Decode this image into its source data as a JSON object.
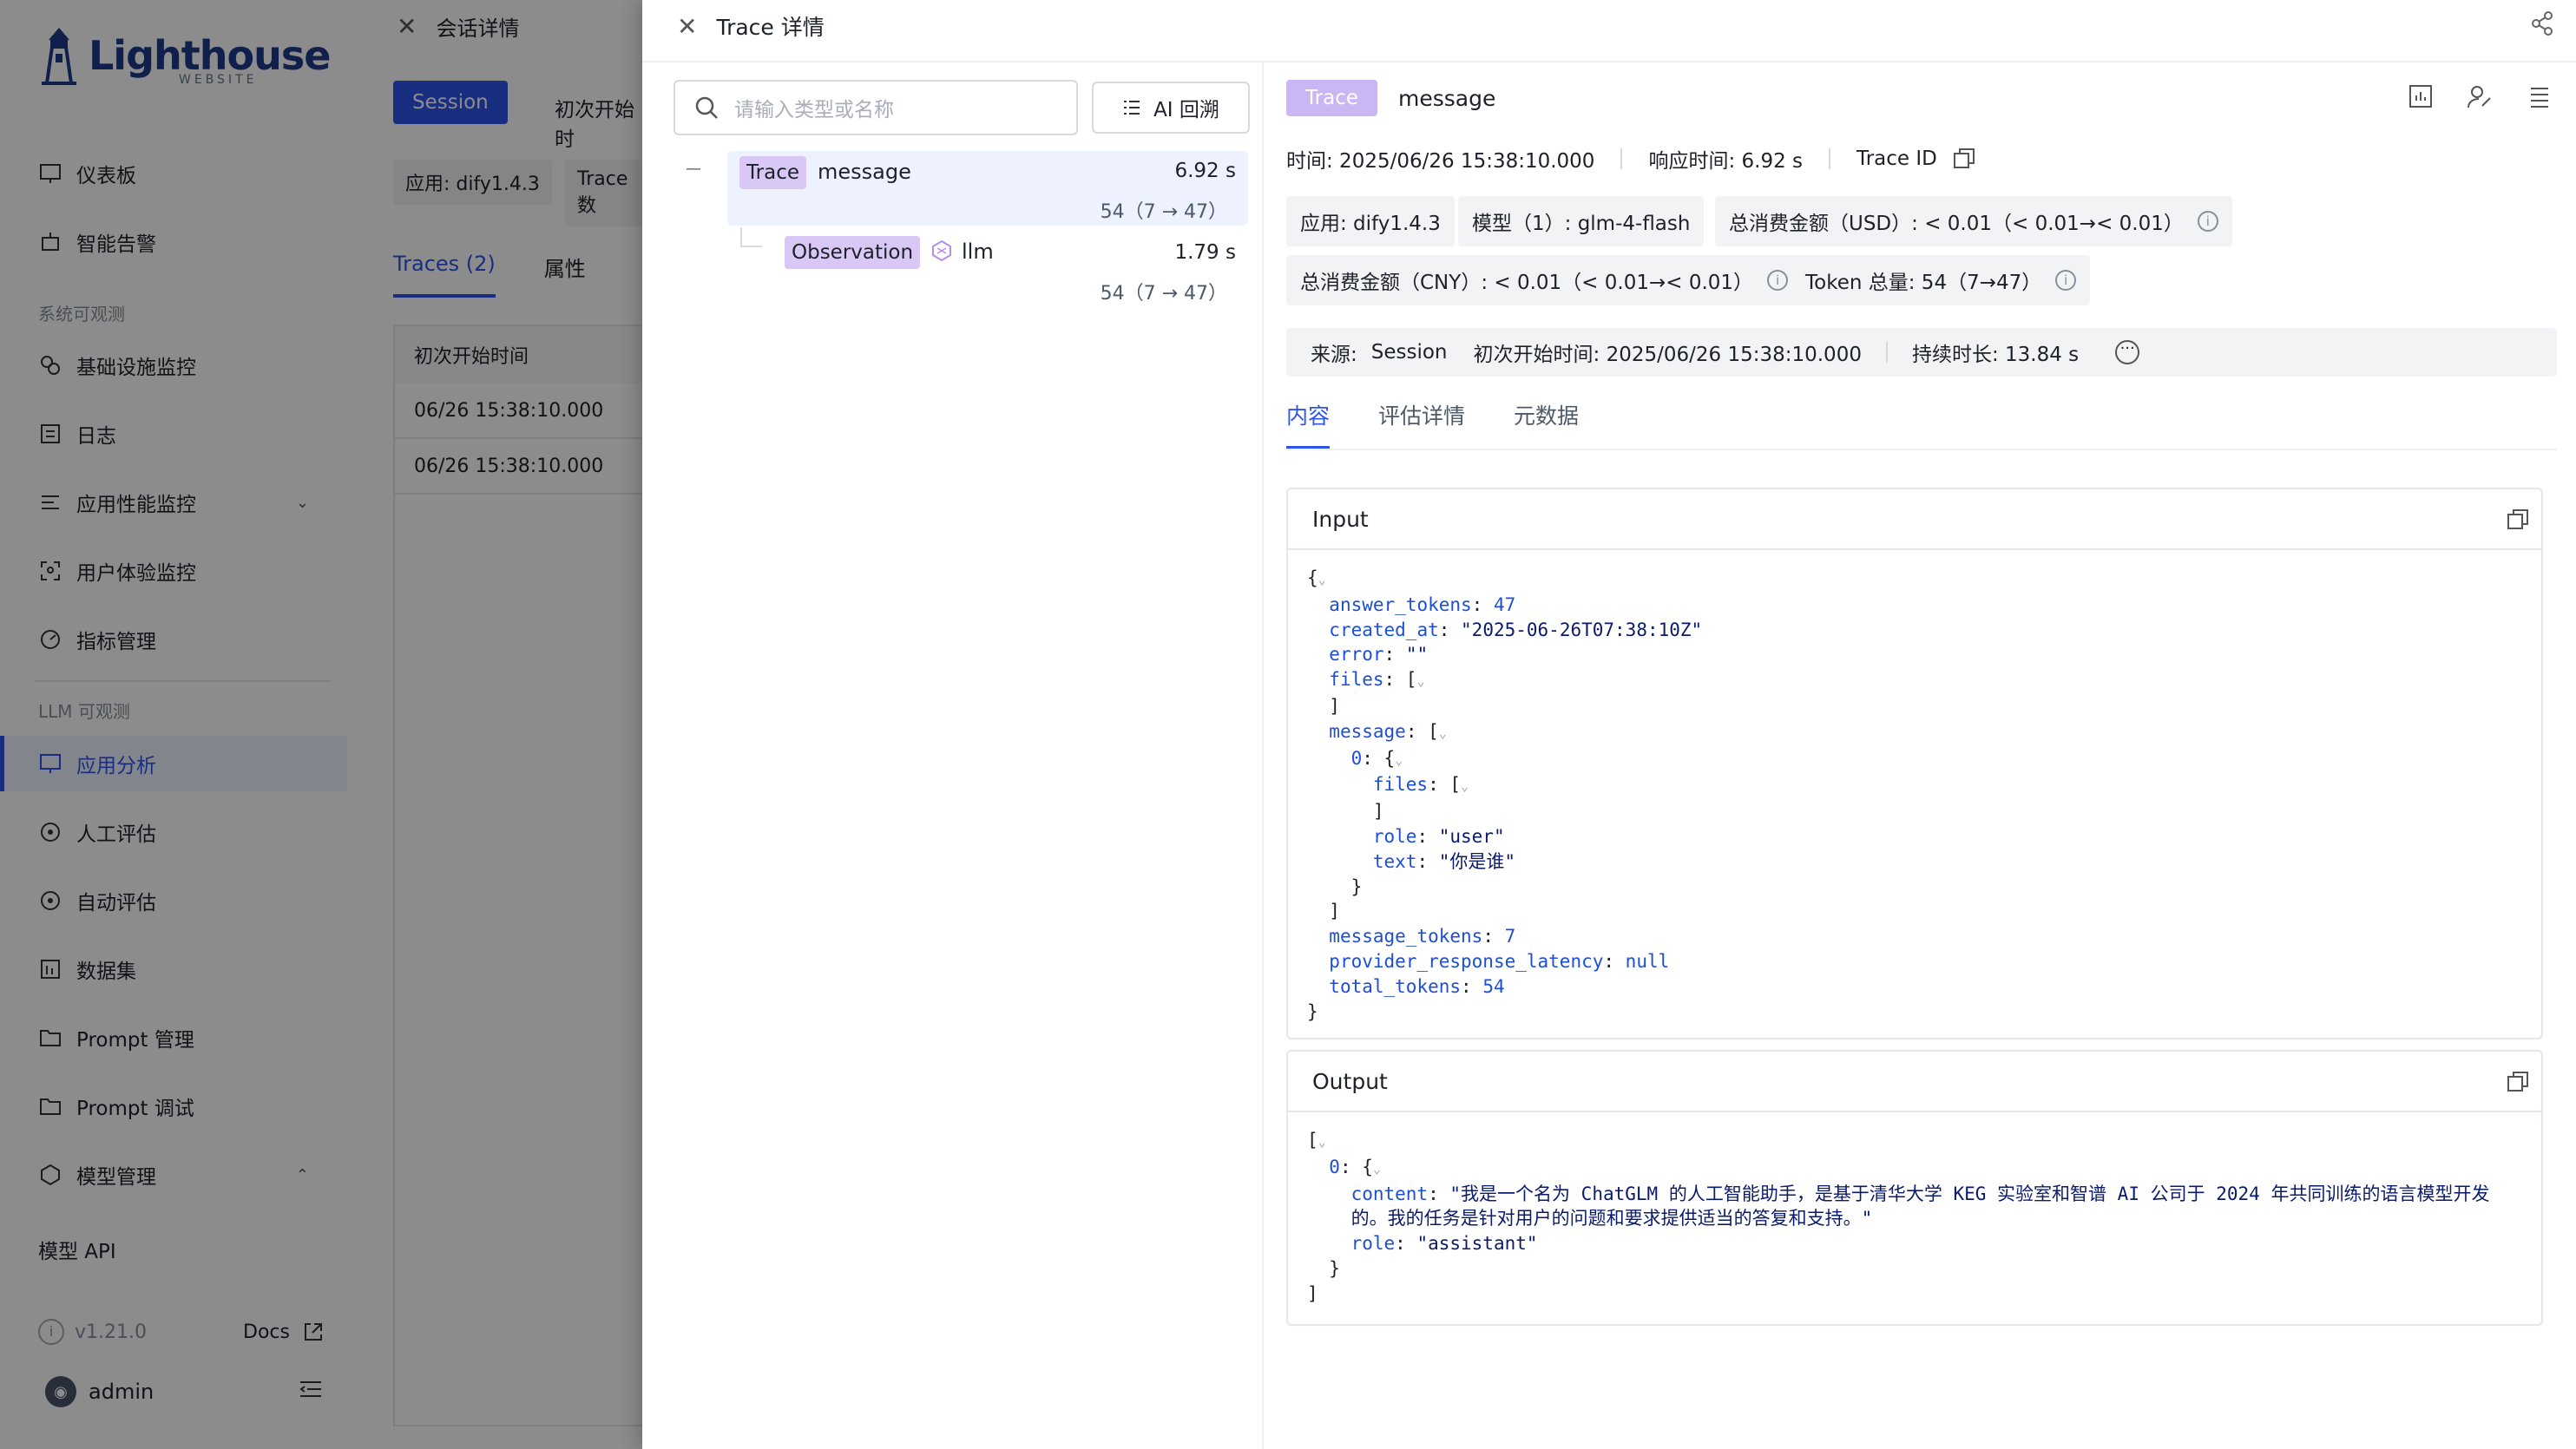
{
  "sidebar": {
    "logo_text": "Lighthouse",
    "logo_sub": "WEBSITE",
    "items": [
      {
        "label": "仪表板",
        "icon": "dashboard-icon"
      },
      {
        "label": "智能告警",
        "icon": "alarm-icon"
      },
      {
        "label": "基础设施监控",
        "icon": "infra-icon"
      },
      {
        "label": "日志",
        "icon": "log-icon"
      },
      {
        "label": "应用性能监控",
        "icon": "apm-icon"
      },
      {
        "label": "用户体验监控",
        "icon": "ux-icon"
      },
      {
        "label": "指标管理",
        "icon": "metric-icon"
      },
      {
        "label": "应用分析",
        "icon": "app-analysis-icon"
      },
      {
        "label": "人工评估",
        "icon": "brain-icon"
      },
      {
        "label": "自动评估",
        "icon": "brain-icon"
      },
      {
        "label": "数据集",
        "icon": "dataset-icon"
      },
      {
        "label": "Prompt 管理",
        "icon": "folder-icon"
      },
      {
        "label": "Prompt 调试",
        "icon": "folder-icon"
      },
      {
        "label": "模型管理",
        "icon": "model-icon"
      },
      {
        "label": "模型 API",
        "icon": ""
      }
    ],
    "group_system": "系统可观测",
    "group_llm": "LLM 可观测",
    "version": "v1.21.0",
    "docs": "Docs",
    "user": "admin"
  },
  "session": {
    "title": "会话详情",
    "session_btn": "Session",
    "first_start": "初次开始时",
    "app_tag": "应用: dify1.4.3",
    "trace_tag": "Trace 数",
    "tab_traces": "Traces (2)",
    "tab_attrs": "属性",
    "table_header": "初次开始时间",
    "rows": [
      "06/26   15:38:10.000",
      "06/26   15:38:10.000"
    ]
  },
  "drawer": {
    "title": "Trace 详情",
    "search_placeholder": "请输入类型或名称",
    "ai_button": "AI 回溯",
    "tree": {
      "collapse": "—",
      "trace_badge": "Trace",
      "trace_name": "message",
      "trace_time": "6.92 s",
      "trace_tokens": "54（7 → 47）",
      "obs_badge": "Observation",
      "obs_name": "llm",
      "obs_time": "1.79 s",
      "obs_tokens": "54（7 → 47）"
    },
    "detail": {
      "tag": "Trace",
      "name": "message",
      "time_label": "时间: 2025/06/26 15:38:10.000",
      "resp_label": "响应时间: 6.92 s",
      "trace_id_label": "Trace ID",
      "app": "应用: dify1.4.3",
      "model": "模型（1）: glm-4-flash",
      "usd": "总消费金额（USD）: < 0.01（< 0.01→< 0.01）",
      "cny": "总消费金额（CNY）: < 0.01（< 0.01→< 0.01）",
      "tokens": "Token 总量: 54（7→47）",
      "source_label": "来源:",
      "source_value": "Session",
      "first_start": "初次开始时间: 2025/06/26 15:38:10.000",
      "duration": "持续时长: 13.84 s",
      "tabs": [
        "内容",
        "评估详情",
        "元数据"
      ],
      "input_title": "Input",
      "output_title": "Output"
    }
  },
  "colors": {
    "accent": "#2f54eb",
    "badge": "#d9c8f5",
    "trace_tag": "#c9b6f2"
  }
}
